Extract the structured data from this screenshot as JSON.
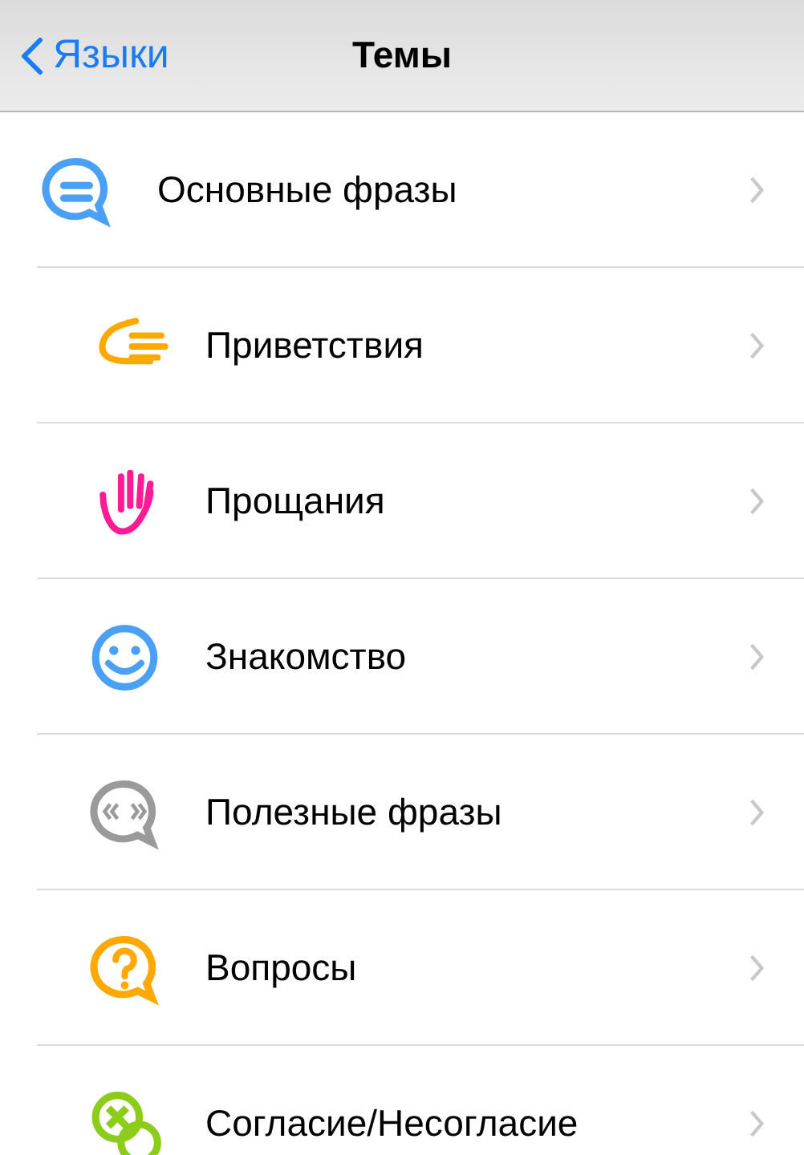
{
  "nav_bar": {
    "back": "Языки",
    "title": "Темы"
  },
  "topics": [
    {
      "label": "Основные фразы",
      "children": [
        {
          "label": "Приветствия"
        },
        {
          "label": "Прощания"
        },
        {
          "label": "Знакомство"
        },
        {
          "label": "Полезные фразы"
        },
        {
          "label": "Вопросы"
        },
        {
          "label": "Согласие/Несогласие"
        }
      ]
    }
  ]
}
